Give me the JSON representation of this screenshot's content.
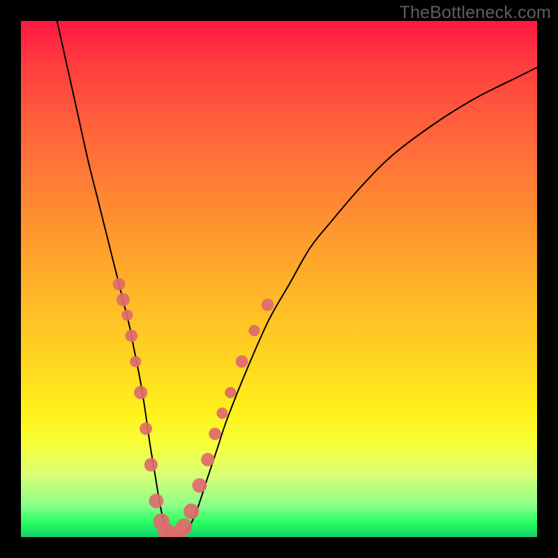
{
  "watermark": "TheBottleneck.com",
  "chart_data": {
    "type": "line",
    "title": "",
    "xlabel": "",
    "ylabel": "",
    "xlim": [
      0,
      100
    ],
    "ylim": [
      0,
      100
    ],
    "curve_x": [
      7,
      9,
      11,
      13,
      15,
      17,
      19,
      20,
      21,
      22,
      23,
      24,
      25,
      26,
      27,
      28,
      29,
      30,
      32,
      34,
      36,
      38,
      40,
      44,
      48,
      52,
      56,
      60,
      66,
      72,
      80,
      88,
      96,
      100
    ],
    "curve_y": [
      100,
      91,
      82,
      73,
      65,
      57,
      49,
      45,
      41,
      36,
      31,
      25,
      18,
      12,
      6,
      2,
      0,
      0,
      1,
      5,
      11,
      17,
      23,
      33,
      42,
      49,
      56,
      61,
      68,
      74,
      80,
      85,
      89,
      91
    ],
    "bead_points": [
      {
        "x": 19.0,
        "y": 49,
        "r": 1.2
      },
      {
        "x": 19.8,
        "y": 46,
        "r": 1.3
      },
      {
        "x": 20.6,
        "y": 43,
        "r": 1.1
      },
      {
        "x": 21.4,
        "y": 39,
        "r": 1.2
      },
      {
        "x": 22.2,
        "y": 34,
        "r": 1.1
      },
      {
        "x": 23.2,
        "y": 28,
        "r": 1.3
      },
      {
        "x": 24.2,
        "y": 21,
        "r": 1.2
      },
      {
        "x": 25.2,
        "y": 14,
        "r": 1.3
      },
      {
        "x": 26.2,
        "y": 7,
        "r": 1.4
      },
      {
        "x": 27.2,
        "y": 3,
        "r": 1.6
      },
      {
        "x": 28.2,
        "y": 1,
        "r": 1.7
      },
      {
        "x": 29.2,
        "y": 0,
        "r": 1.7
      },
      {
        "x": 30.4,
        "y": 0.5,
        "r": 1.7
      },
      {
        "x": 31.6,
        "y": 2,
        "r": 1.6
      },
      {
        "x": 33.0,
        "y": 5,
        "r": 1.5
      },
      {
        "x": 34.6,
        "y": 10,
        "r": 1.4
      },
      {
        "x": 36.2,
        "y": 15,
        "r": 1.3
      },
      {
        "x": 37.6,
        "y": 20,
        "r": 1.2
      },
      {
        "x": 39.0,
        "y": 24,
        "r": 1.1
      },
      {
        "x": 40.6,
        "y": 28,
        "r": 1.1
      },
      {
        "x": 42.8,
        "y": 34,
        "r": 1.2
      },
      {
        "x": 45.2,
        "y": 40,
        "r": 1.1
      },
      {
        "x": 47.8,
        "y": 45,
        "r": 1.2
      }
    ],
    "gradient_stops": [
      {
        "pos": 0.0,
        "color": "#ff1744"
      },
      {
        "pos": 0.5,
        "color": "#ffcf22"
      },
      {
        "pos": 0.95,
        "color": "#55ff70"
      },
      {
        "pos": 1.0,
        "color": "#12d26a"
      }
    ]
  }
}
